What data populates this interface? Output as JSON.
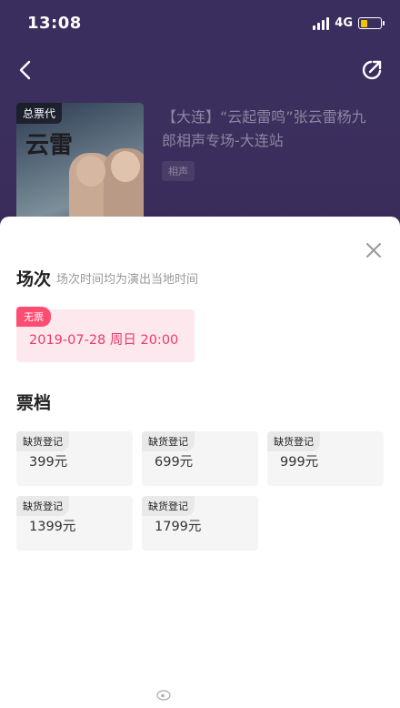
{
  "status_bar": {
    "time": "13:08",
    "network": "4G"
  },
  "event": {
    "poster_tag": "总票代",
    "poster_title": "云雷",
    "title": "【大连】“云起雷鸣”张云雷杨九郎相声专场-大连站",
    "category": "相声"
  },
  "sheet": {
    "session_title": "场次",
    "session_note": "场次时间均为演出当地时间",
    "session": {
      "badge": "无票",
      "datetime": "2019-07-28 周日 20:00"
    },
    "ticket_title": "票档",
    "tickets": [
      {
        "badge": "缺货登记",
        "price": "399元"
      },
      {
        "badge": "缺货登记",
        "price": "699元"
      },
      {
        "badge": "缺货登记",
        "price": "999元"
      },
      {
        "badge": "缺货登记",
        "price": "1399元"
      },
      {
        "badge": "缺货登记",
        "price": "1799元"
      }
    ]
  },
  "colors": {
    "header_bg": "#3a2e5e",
    "accent_pink": "#ff4d72",
    "session_text": "#ee3a6a",
    "session_bg": "#fde8ee",
    "battery": "#f5c400"
  },
  "icons": {
    "back": "chevron-left-icon",
    "share": "share-icon",
    "close": "close-icon"
  }
}
